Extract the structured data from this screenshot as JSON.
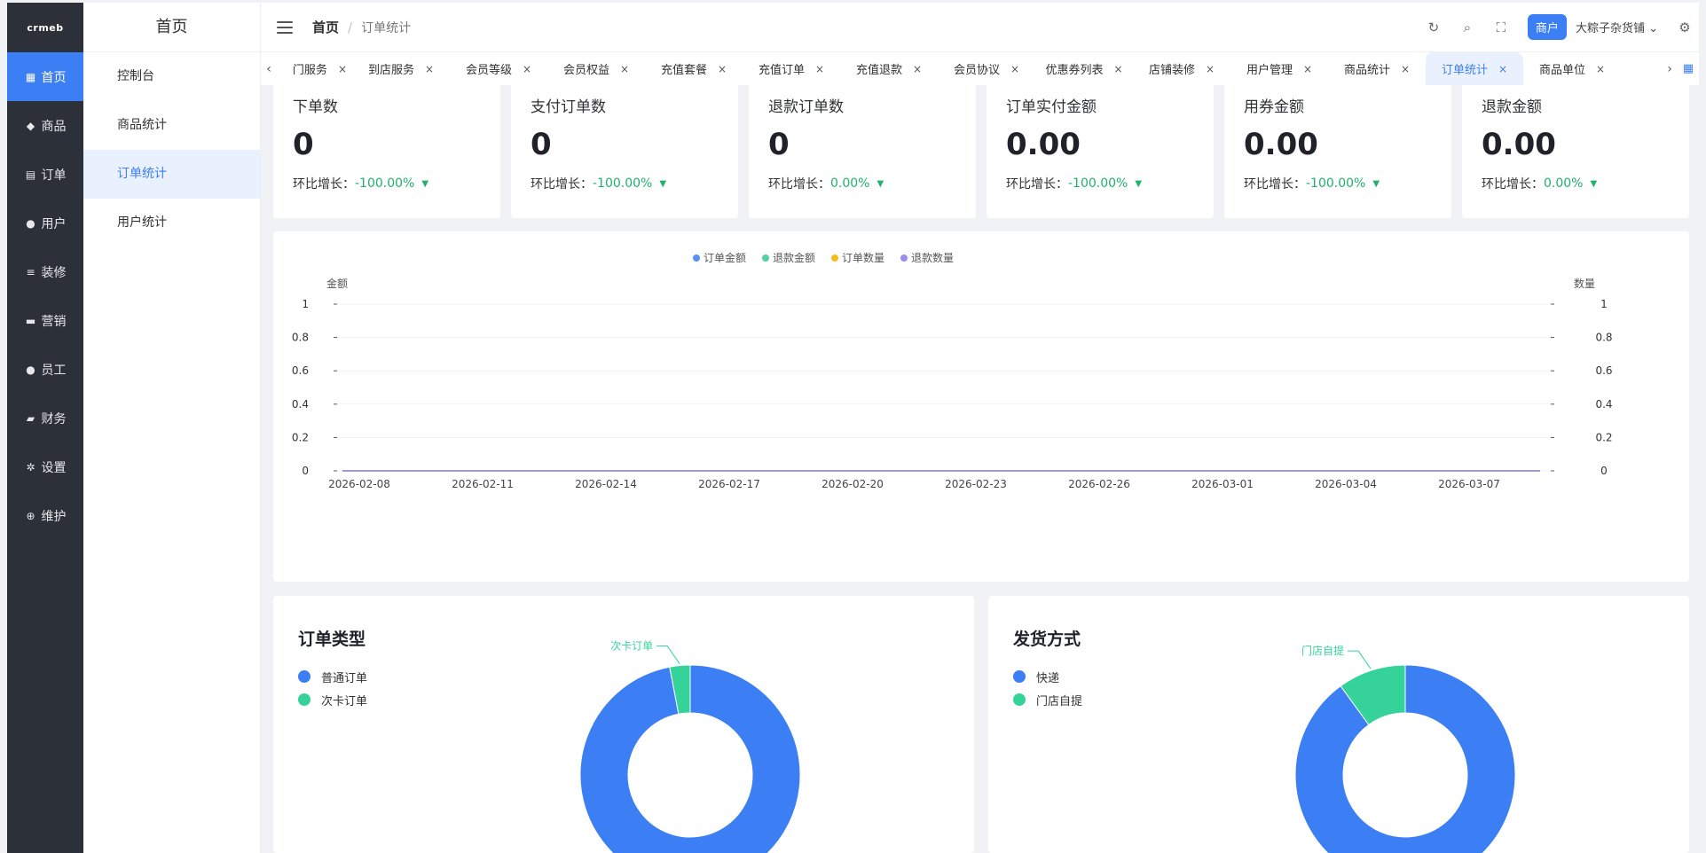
{
  "brand": {
    "logo_text": "crmeb",
    "accent": "#3c7ef3"
  },
  "rail": {
    "items": [
      {
        "label": "首页",
        "icon": "grid-icon",
        "glyph": "▦",
        "active": true
      },
      {
        "label": "商品",
        "icon": "bag-icon",
        "glyph": "◆",
        "active": false
      },
      {
        "label": "订单",
        "icon": "clipboard-icon",
        "glyph": "▤",
        "active": false
      },
      {
        "label": "用户",
        "icon": "user-icon",
        "glyph": "●",
        "active": false
      },
      {
        "label": "装修",
        "icon": "sliders-icon",
        "glyph": "≡",
        "active": false
      },
      {
        "label": "营销",
        "icon": "shop-icon",
        "glyph": "▬",
        "active": false
      },
      {
        "label": "员工",
        "icon": "staff-icon",
        "glyph": "●",
        "active": false
      },
      {
        "label": "财务",
        "icon": "wallet-icon",
        "glyph": "▰",
        "active": false
      },
      {
        "label": "设置",
        "icon": "gear-icon",
        "glyph": "✲",
        "active": false
      },
      {
        "label": "维护",
        "icon": "plus-circle-icon",
        "glyph": "⊕",
        "active": false
      }
    ]
  },
  "sub": {
    "title": "首页",
    "items": [
      {
        "label": "控制台",
        "active": false
      },
      {
        "label": "商品统计",
        "active": false
      },
      {
        "label": "订单统计",
        "active": true
      },
      {
        "label": "用户统计",
        "active": false
      }
    ]
  },
  "header": {
    "breadcrumb_home": "首页",
    "breadcrumb_sep": "/",
    "breadcrumb_current": "订单统计",
    "role_badge": "商户",
    "shop_name": "大粽子杂货铺"
  },
  "tabs": {
    "items": [
      {
        "label": "门服务",
        "active": false
      },
      {
        "label": "到店服务",
        "active": false
      },
      {
        "label": "会员等级",
        "active": false
      },
      {
        "label": "会员权益",
        "active": false
      },
      {
        "label": "充值套餐",
        "active": false
      },
      {
        "label": "充值订单",
        "active": false
      },
      {
        "label": "充值退款",
        "active": false
      },
      {
        "label": "会员协议",
        "active": false
      },
      {
        "label": "优惠券列表",
        "active": false
      },
      {
        "label": "店铺装修",
        "active": false
      },
      {
        "label": "用户管理",
        "active": false
      },
      {
        "label": "商品统计",
        "active": false
      },
      {
        "label": "订单统计",
        "active": true
      },
      {
        "label": "商品单位",
        "active": false
      }
    ]
  },
  "stats": {
    "growth_label": "环比增长：",
    "cards": [
      {
        "label": "下单数",
        "value": "0",
        "growth": "-100.00%"
      },
      {
        "label": "支付订单数",
        "value": "0",
        "growth": "-100.00%"
      },
      {
        "label": "退款订单数",
        "value": "0",
        "growth": "0.00%"
      },
      {
        "label": "订单实付金额",
        "value": "0.00",
        "growth": "-100.00%"
      },
      {
        "label": "用券金额",
        "value": "0.00",
        "growth": "-100.00%"
      },
      {
        "label": "退款金额",
        "value": "0.00",
        "growth": "0.00%"
      }
    ]
  },
  "line_chart": {
    "type": "line",
    "left_axis_label": "金额",
    "right_axis_label": "数量",
    "yticks": [
      "0",
      "0.2",
      "0.4",
      "0.6",
      "0.8",
      "1"
    ],
    "ylim": [
      0,
      1
    ],
    "x_tick_labels": [
      "2026-02-08",
      "2026-02-11",
      "2026-02-14",
      "2026-02-17",
      "2026-02-20",
      "2026-02-23",
      "2026-02-26",
      "2026-03-01",
      "2026-03-04",
      "2026-03-07"
    ],
    "legend_position": "top-center",
    "series": [
      {
        "name": "订单金额",
        "color": "#5b8ff9"
      },
      {
        "name": "退款金额",
        "color": "#4fd1a5"
      },
      {
        "name": "订单数量",
        "color": "#f6bd16"
      },
      {
        "name": "退款数量",
        "color": "#9a8cf0"
      }
    ]
  },
  "order_type": {
    "title": "订单类型",
    "legend": [
      {
        "name": "普通订单",
        "color": "#3c7ef3",
        "value": 97
      },
      {
        "name": "次卡订单",
        "color": "#35d39a",
        "value": 3
      }
    ],
    "callout": "次卡订单"
  },
  "delivery": {
    "title": "发货方式",
    "legend": [
      {
        "name": "快递",
        "color": "#3c7ef3",
        "value": 90
      },
      {
        "name": "门店自提",
        "color": "#35d39a",
        "value": 10
      }
    ],
    "callout": "门店自提"
  }
}
